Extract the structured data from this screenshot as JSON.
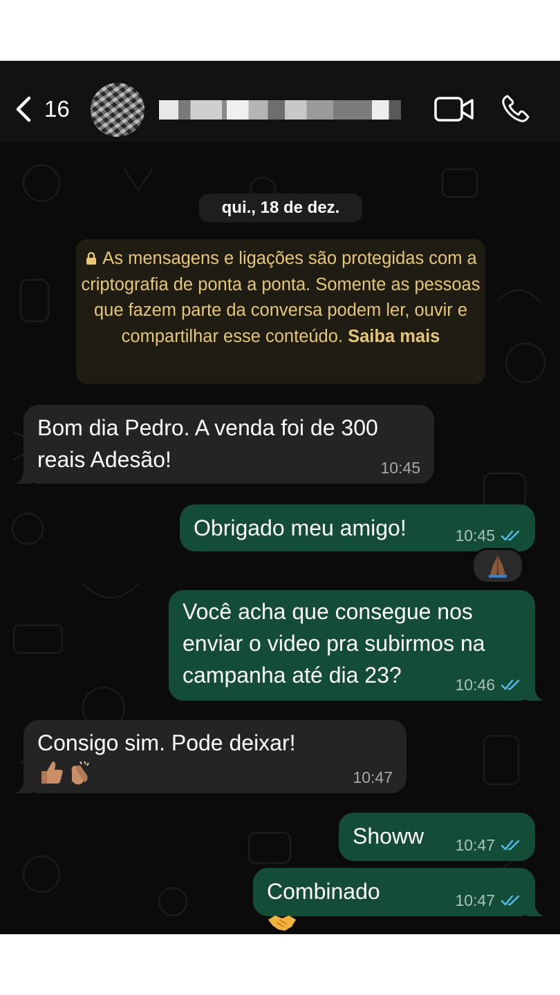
{
  "header": {
    "unread_count": "16",
    "contact_name": "██████████"
  },
  "chat": {
    "date_chip": "qui., 18 de dez.",
    "encryption_notice": {
      "text": "As mensagens e ligações são protegidas com a criptografia de ponta a ponta. Somente as pessoas que fazem parte da conversa podem ler, ouvir e compartilhar esse conteúdo.",
      "link": "Saiba mais"
    },
    "messages": [
      {
        "direction": "incoming",
        "text": "Bom dia Pedro. A venda foi de 300\nreais Adesão!",
        "time": "10:45"
      },
      {
        "direction": "outgoing",
        "text": "Obrigado meu amigo!",
        "time": "10:45",
        "status": "read",
        "reaction": "folded-hands"
      },
      {
        "direction": "outgoing",
        "text": "Você acha que consegue nos\nenviar o video pra subirmos na\ncampanha até dia 23?",
        "time": "10:46",
        "status": "read"
      },
      {
        "direction": "incoming",
        "text": "Consigo sim. Pode deixar!",
        "emojis": [
          "thumbs-up",
          "clapping-hands"
        ],
        "time": "10:47"
      },
      {
        "direction": "outgoing",
        "text": "Showw",
        "time": "10:47",
        "status": "read"
      },
      {
        "direction": "outgoing",
        "text": "Combinado",
        "emojis": [
          "handshake"
        ],
        "time": "10:47",
        "status": "read"
      }
    ]
  },
  "icons": {
    "back": "chevron-left-icon",
    "video_call": "video-camera-icon",
    "voice_call": "phone-icon",
    "lock": "lock-icon",
    "read_receipt": "double-check-icon"
  },
  "colors": {
    "background": "#0b0b0b",
    "header": "#121212",
    "incoming_bubble": "#242424",
    "outgoing_bubble": "#134d37",
    "notice_text": "#e8c772",
    "read_ticks": "#53bdeb"
  }
}
